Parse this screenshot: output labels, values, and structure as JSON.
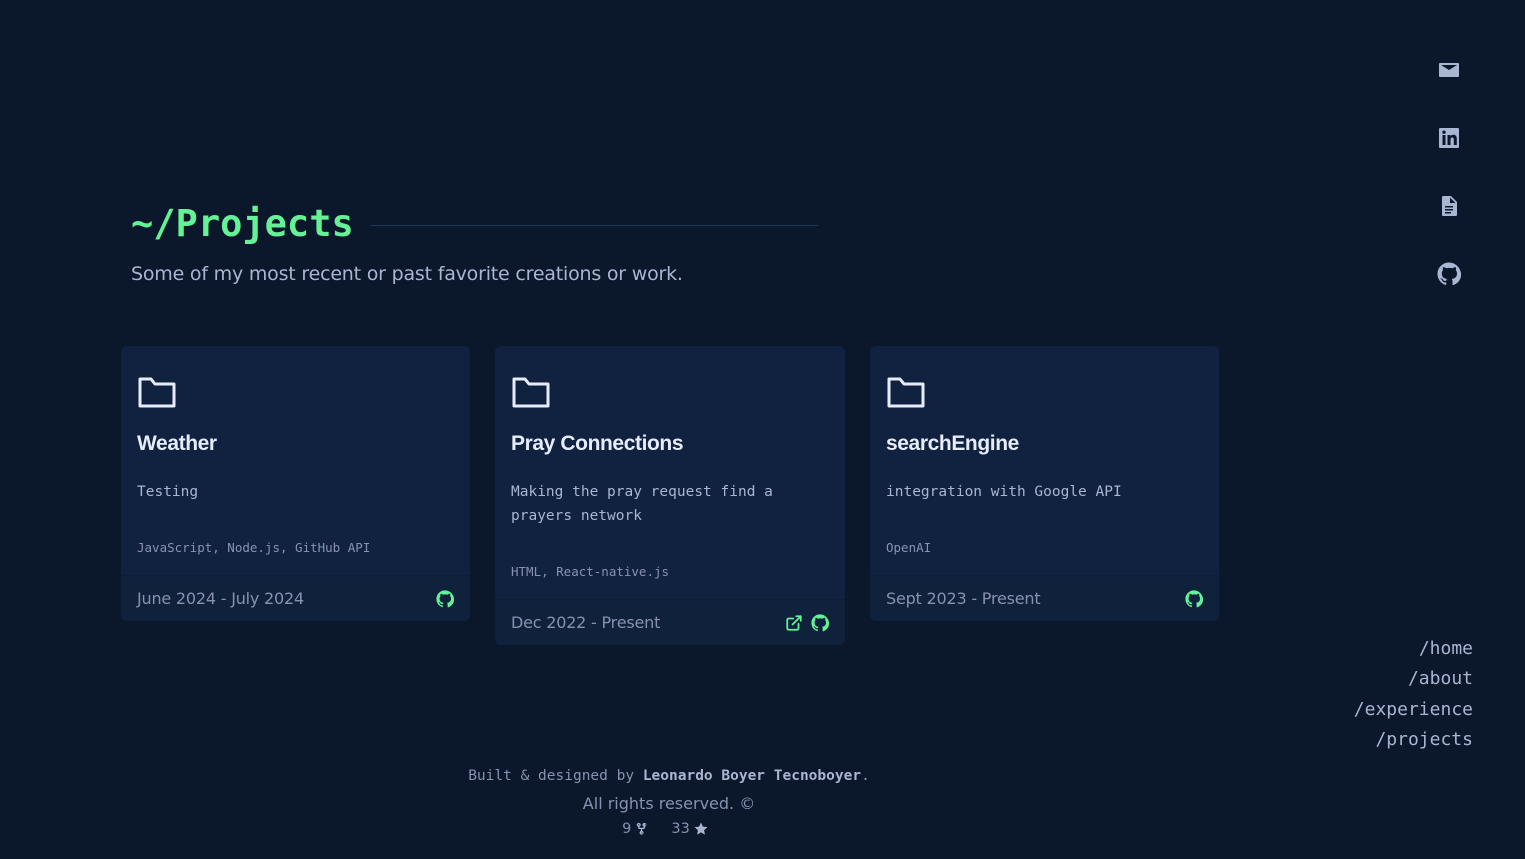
{
  "heading": {
    "title": "~/Projects",
    "subtitle": "Some of my most recent or past favorite creations or work."
  },
  "projects": [
    {
      "title": "Weather",
      "description": "Testing",
      "tech": "JavaScript, Node.js, GitHub API",
      "date": "June 2024 - July 2024",
      "links": [
        "github-icon"
      ]
    },
    {
      "title": "Pray Connections",
      "description": "Making the pray request find a prayers network",
      "tech": "HTML, React-native.js",
      "date": "Dec 2022 - Present",
      "links": [
        "external-link-icon",
        "github-icon"
      ]
    },
    {
      "title": "searchEngine",
      "description": "integration with Google API",
      "tech": "OpenAI",
      "date": "Sept 2023 - Present",
      "links": [
        "github-icon"
      ]
    }
  ],
  "social": [
    "mail-icon",
    "linkedin-icon",
    "resume-icon",
    "github-icon"
  ],
  "nav": [
    "/home",
    "/about",
    "/experience",
    "/projects"
  ],
  "footer": {
    "built_prefix": "Built & designed by ",
    "author": "Leonardo Boyer Tecnoboyer",
    "built_suffix": ".",
    "rights": "All rights reserved. ©",
    "forks": "9",
    "stars": "33"
  },
  "colors": {
    "background": "#0b172a",
    "card": "#112240",
    "accent": "#64f296",
    "text": "#a9b6d1"
  }
}
